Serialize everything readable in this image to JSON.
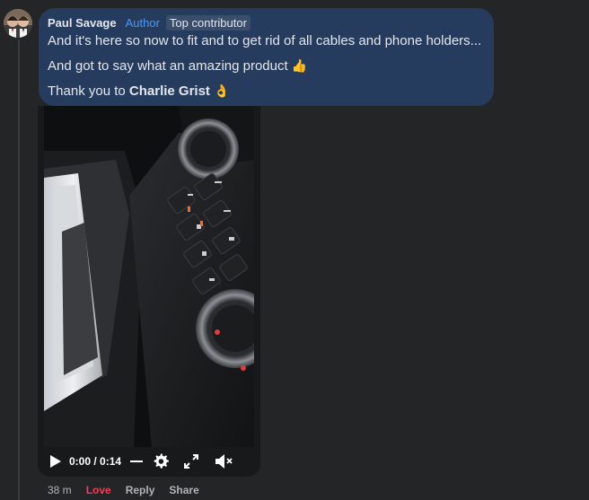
{
  "comment": {
    "author": "Paul Savage",
    "badges": {
      "author_label": "Author",
      "top_label": "Top contributor"
    },
    "lines": {
      "line1": "And it's here so now to fit and to get rid of all cables and phone holders...",
      "line2_text": "And got to say what an amazing product",
      "line2_emoji": "👍",
      "line3_text": "Thank you to ",
      "line3_mention": "Charlie Grist",
      "line3_emoji": "👌"
    }
  },
  "video": {
    "time_display": "0:00 / 0:14",
    "progress": 0,
    "icons": {
      "play": "play-icon",
      "settings": "gear-icon",
      "fullscreen": "fullscreen-icon",
      "mute": "volume-muted-icon"
    }
  },
  "actions": {
    "time_ago": "38 m",
    "love_label": "Love",
    "reply_label": "Reply",
    "share_label": "Share"
  },
  "colors": {
    "background": "#242526",
    "bubble": "#263c5e",
    "author_badge": "#4599ff",
    "love": "#f33e58",
    "muted_text": "#b0b3b8"
  }
}
